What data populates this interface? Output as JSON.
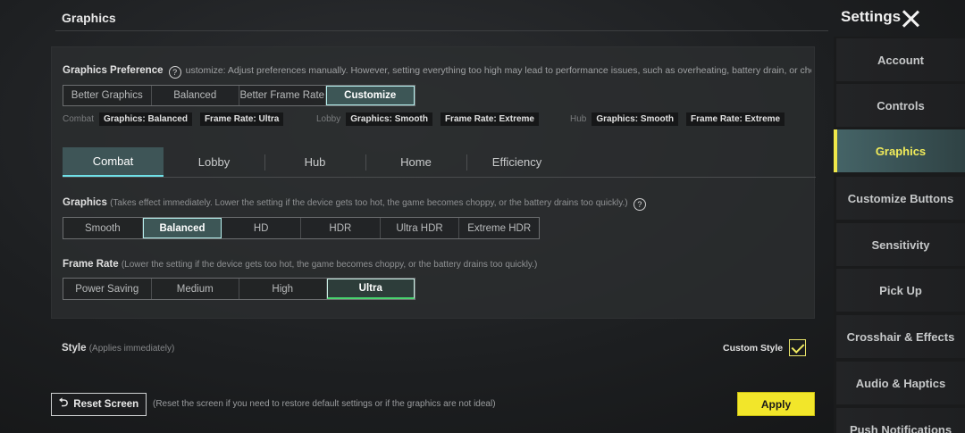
{
  "header": {
    "section_title": "Graphics",
    "settings_title": "Settings"
  },
  "preference": {
    "label": "Graphics Preference",
    "help": "?",
    "description": "ustomize: Adjust preferences manually. However, setting everything too high may lead to performance issues, such as overheating, battery drain, or choppy g",
    "options": [
      "Better Graphics",
      "Balanced",
      "Better Frame Rate",
      "Customize"
    ],
    "selected": "Customize"
  },
  "presets": [
    {
      "name": "Combat",
      "graphics": "Graphics: Balanced",
      "frame_rate": "Frame Rate: Ultra"
    },
    {
      "name": "Lobby",
      "graphics": "Graphics: Smooth",
      "frame_rate": "Frame Rate: Extreme"
    },
    {
      "name": "Hub",
      "graphics": "Graphics: Smooth",
      "frame_rate": "Frame Rate: Extreme"
    }
  ],
  "tabs": [
    "Combat",
    "Lobby",
    "Hub",
    "Home",
    "Efficiency"
  ],
  "active_tab": "Combat",
  "graphics": {
    "label": "Graphics",
    "note": "(Takes effect immediately. Lower the setting if the device gets too hot, the game becomes choppy, or the battery drains too quickly.)",
    "help": "?",
    "options": [
      "Smooth",
      "Balanced",
      "HD",
      "HDR",
      "Ultra HDR",
      "Extreme HDR"
    ],
    "selected": "Balanced"
  },
  "frame_rate": {
    "label": "Frame Rate",
    "note": "(Lower the setting if the device gets too hot, the game becomes choppy, or the battery drains too quickly.)",
    "options": [
      "Power Saving",
      "Medium",
      "High",
      "Ultra"
    ],
    "selected": "Ultra"
  },
  "style": {
    "label": "Style",
    "note": "(Applies immediately)",
    "custom_label": "Custom Style",
    "custom_checked": true
  },
  "footer": {
    "reset_label": "Reset Screen",
    "reset_note": "(Reset the screen if you need to restore default settings or if the graphics are not ideal)",
    "apply_label": "Apply"
  },
  "sidebar": {
    "items": [
      "Account",
      "Controls",
      "Graphics",
      "Customize Buttons",
      "Sensitivity",
      "Pick Up",
      "Crosshair & Effects",
      "Audio & Haptics",
      "Push Notifications"
    ],
    "active": "Graphics"
  },
  "colors": {
    "accent_yellow": "#f2e62a",
    "selected_teal": "#3d5656",
    "selected_border": "#b7f0ee"
  }
}
